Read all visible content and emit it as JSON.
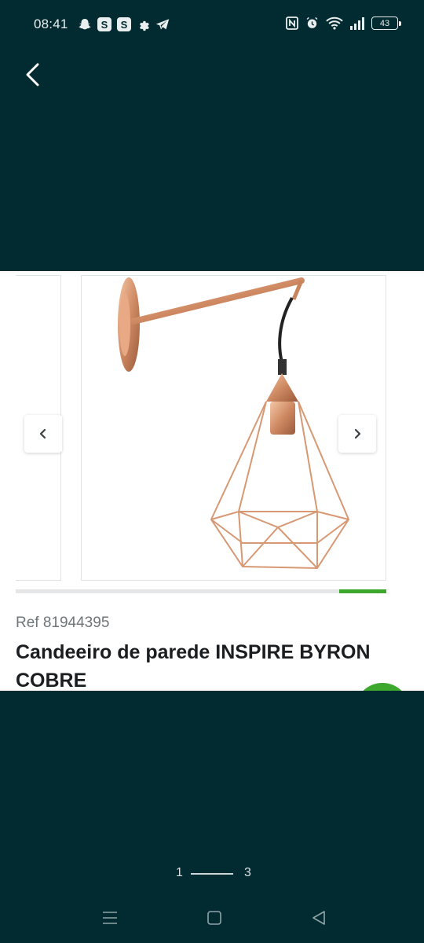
{
  "status_bar": {
    "time": "08:41",
    "left_icons": [
      "snapchat-icon",
      "s-app-icon",
      "s-app-icon",
      "settings-icon",
      "telegram-icon"
    ],
    "s_app_label": "S",
    "right_icons": [
      "nfc-icon",
      "alarm-icon",
      "wifi-icon",
      "signal-icon",
      "battery-icon"
    ],
    "battery_level": "43"
  },
  "toolbar": {
    "back_icon": "chevron-left-icon"
  },
  "product": {
    "ref": "Ref 81944395",
    "title": "Candeeiro de parede INSPIRE BYRON COBRE"
  },
  "gallery": {
    "prev_icon": "chevron-left-icon",
    "next_icon": "chevron-right-icon",
    "progress_fraction": 0.13
  },
  "pager": {
    "current": "1",
    "total": "3"
  },
  "system_nav": {
    "icons": [
      "menu-icon",
      "home-icon",
      "back-triangle-icon"
    ]
  },
  "colors": {
    "background": "#022b31",
    "accent": "#3ea72d",
    "copper": "#d3906b"
  }
}
